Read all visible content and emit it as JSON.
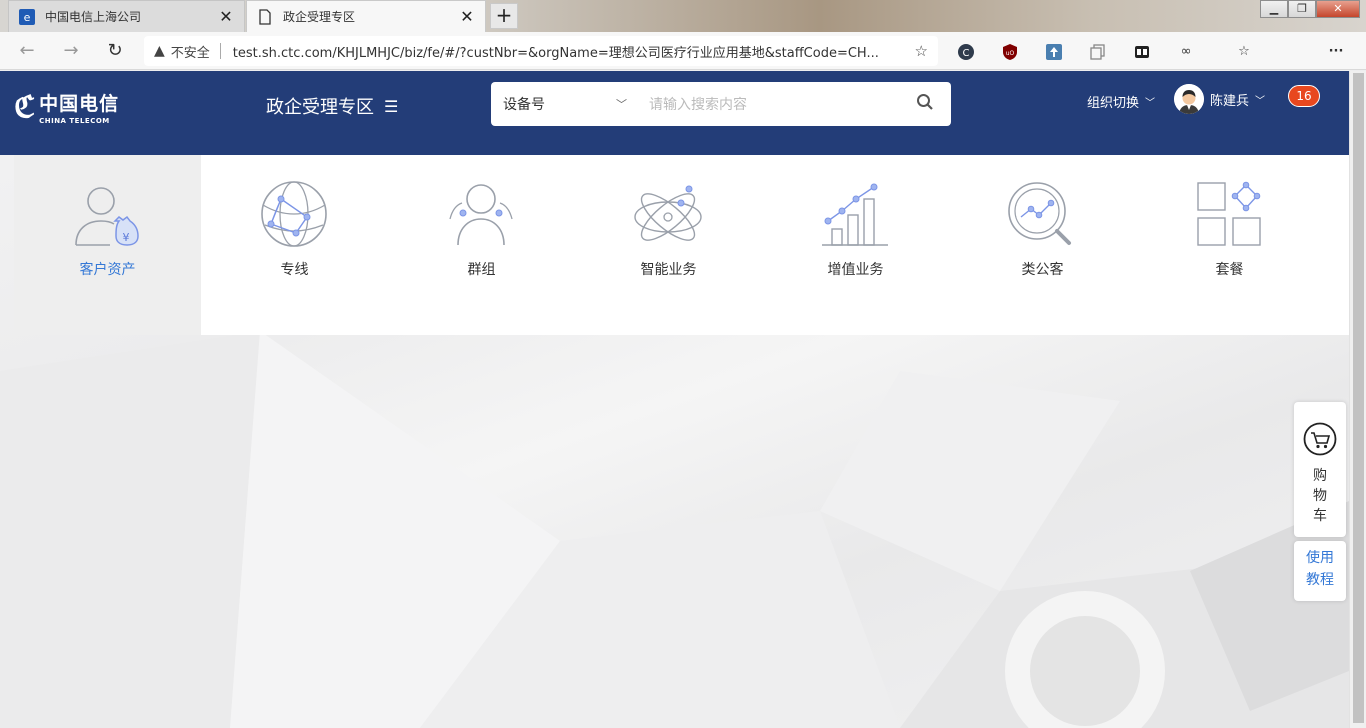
{
  "browser": {
    "tabs": [
      {
        "title": "中国电信上海公司",
        "active": false
      },
      {
        "title": "政企受理专区",
        "active": true
      }
    ],
    "address": {
      "security_label": "不安全",
      "url": "test.sh.ctc.com/KHJLMHJC/biz/fe/#/?custNbr=&orgName=理想公司医疗行业应用基地&staffCode=CH..."
    }
  },
  "header": {
    "logo_cn": "中国电信",
    "logo_en": "CHINA TELECOM",
    "zone_title": "政企受理专区",
    "search": {
      "type_selected": "设备号",
      "placeholder": "请输入搜索内容"
    },
    "org_switch": "组织切换",
    "user_name": "陈建兵",
    "notification_count": "16"
  },
  "categories": [
    {
      "label": "客户资产",
      "icon": "customer-asset-icon",
      "active": true
    },
    {
      "label": "专线",
      "icon": "globe-icon",
      "active": false
    },
    {
      "label": "群组",
      "icon": "group-icon",
      "active": false
    },
    {
      "label": "智能业务",
      "icon": "atom-icon",
      "active": false
    },
    {
      "label": "增值业务",
      "icon": "bar-chart-icon",
      "active": false
    },
    {
      "label": "类公客",
      "icon": "magnifier-chart-icon",
      "active": false
    },
    {
      "label": "套餐",
      "icon": "package-grid-icon",
      "active": false
    }
  ],
  "floating": {
    "cart_chars": [
      "购",
      "物",
      "车"
    ],
    "help_chars": [
      "使用",
      "教程"
    ]
  },
  "colors": {
    "header_bg": "#233d78",
    "accent": "#3478d6",
    "badge": "#e8481f",
    "icon_stroke": "#9aa0aa",
    "icon_node": "#7c95e6"
  }
}
